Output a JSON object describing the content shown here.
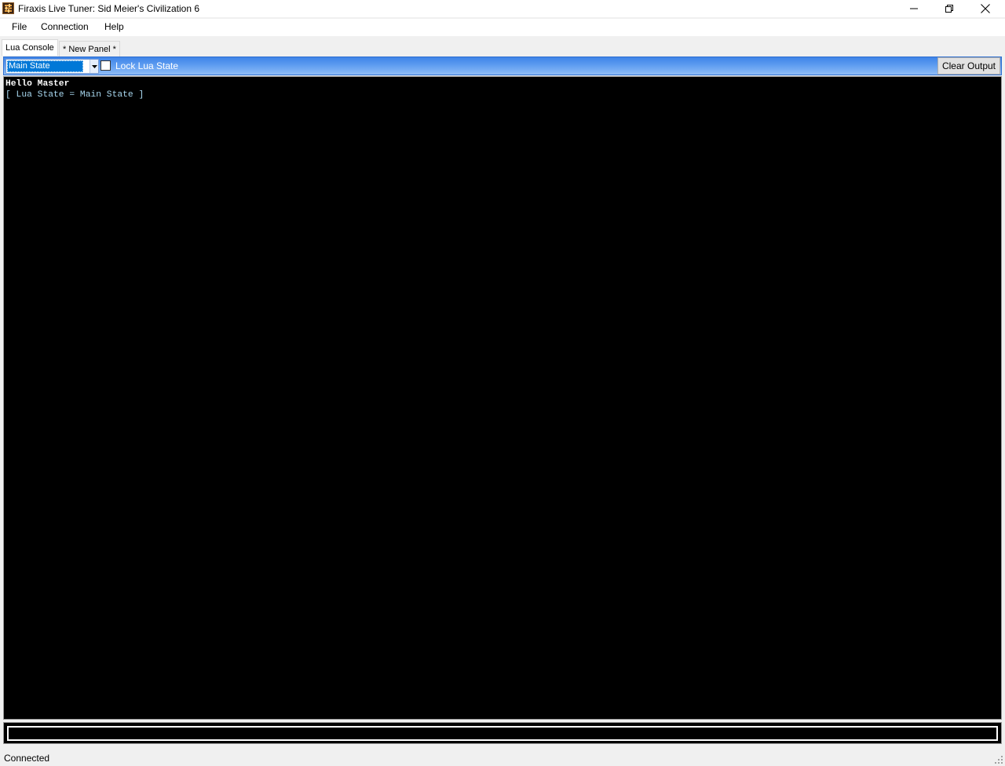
{
  "window": {
    "title": "Firaxis Live Tuner: Sid Meier's Civilization 6",
    "app_icon": "firaxis-tuner-icon"
  },
  "menu": {
    "items": [
      "File",
      "Connection",
      "Help"
    ]
  },
  "tabs": [
    {
      "label": "Lua Console",
      "active": true
    },
    {
      "label": "* New Panel *",
      "active": false
    }
  ],
  "toolbar": {
    "lua_state": "Main State",
    "lock_label": "Lock Lua State",
    "lock_checked": false,
    "clear_label": "Clear Output"
  },
  "console": {
    "lines": [
      "Hello Master",
      "[ Lua State = Main State ]"
    ],
    "input_value": ""
  },
  "status": {
    "text": "Connected"
  },
  "colors": {
    "toolbar_gradient_top": "#3f84e8",
    "toolbar_gradient_bottom": "#8fbcf6",
    "console_bg": "#000000",
    "line1_color": "#ffffff",
    "line2_color": "#a8d8f0",
    "selection": "#0078d7"
  }
}
